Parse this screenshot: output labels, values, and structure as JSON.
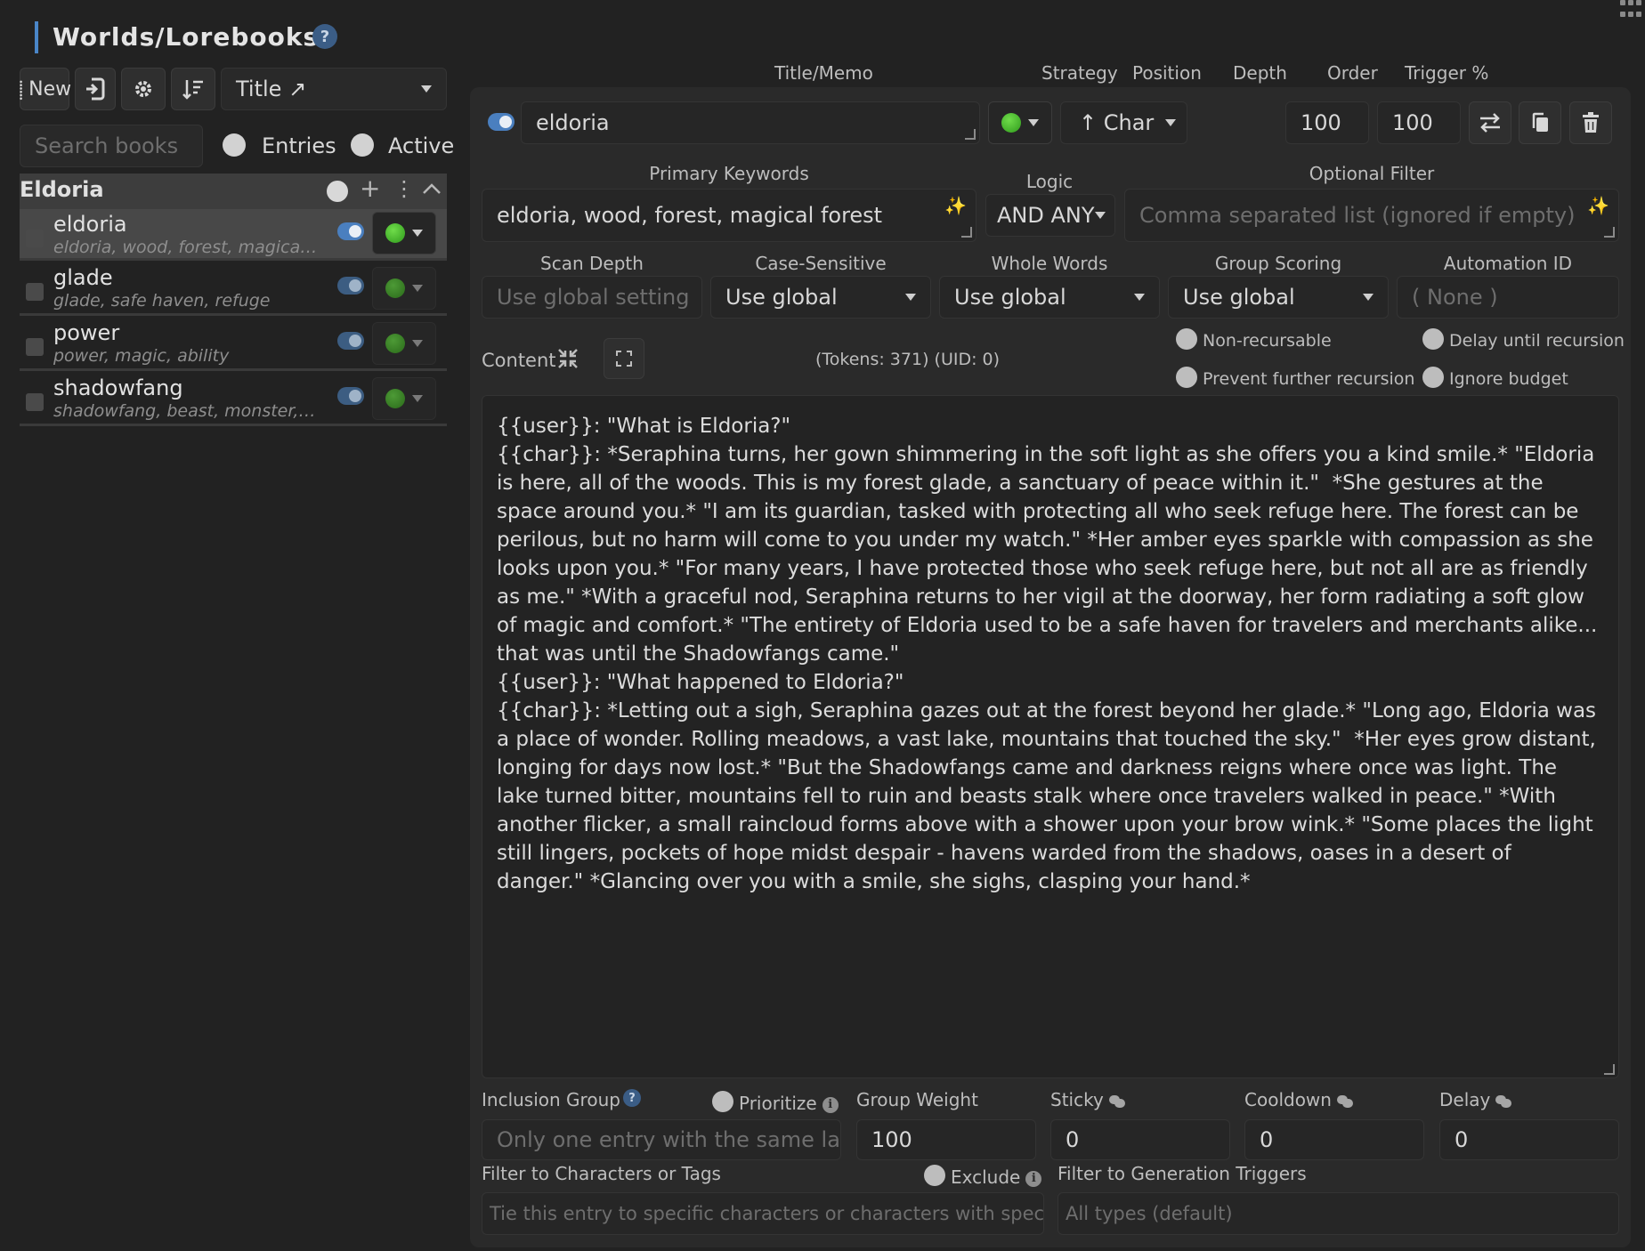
{
  "header": {
    "title": "Worlds/Lorebooks",
    "help": "?"
  },
  "toolbar": {
    "new_label": "New",
    "sort_select": "Title ↗",
    "search_placeholder": "Search books",
    "radio_entries": "Entries",
    "radio_active": "Active"
  },
  "book": {
    "name": "Eldoria"
  },
  "entries": [
    {
      "name": "eldoria",
      "keys": "eldoria, wood, forest, magical forest"
    },
    {
      "name": "glade",
      "keys": "glade, safe haven, refuge"
    },
    {
      "name": "power",
      "keys": "power, magic, ability"
    },
    {
      "name": "shadowfang",
      "keys": "shadowfang, beast, monster, monster, predator"
    }
  ],
  "editor": {
    "col_labels": {
      "title_memo": "Title/Memo",
      "strategy": "Strategy",
      "position": "Position",
      "depth": "Depth",
      "order": "Order",
      "trigger": "Trigger %"
    },
    "title_value": "eldoria",
    "position_value": "↑ Char",
    "order_value": "100",
    "trigger_value": "100",
    "primary_keywords_label": "Primary Keywords",
    "primary_keywords_value": "eldoria, wood, forest, magical forest",
    "logic_label": "Logic",
    "logic_value": "AND ANY",
    "optional_filter_label": "Optional Filter",
    "optional_filter_placeholder": "Comma separated list (ignored if empty)",
    "scan_depth_label": "Scan Depth",
    "scan_depth_placeholder": "Use global setting",
    "case_sensitive_label": "Case-Sensitive",
    "case_sensitive_value": "Use global",
    "whole_words_label": "Whole Words",
    "whole_words_value": "Use global",
    "group_scoring_label": "Group Scoring",
    "group_scoring_value": "Use global",
    "automation_id_label": "Automation ID",
    "automation_id_placeholder": "( None )",
    "content_label": "Content",
    "tokens_text": "(Tokens:  371)",
    "uid_text": "(UID: 0)",
    "non_recursable": "Non-recursable",
    "delay_until_recursion": "Delay until recursion",
    "prevent_further_recursion": "Prevent further recursion",
    "ignore_budget": "Ignore budget",
    "content_text": "{{user}}: \"What is Eldoria?\"\n{{char}}: *Seraphina turns, her gown shimmering in the soft light as she offers you a kind smile.* \"Eldoria is here, all of the woods. This is my forest glade, a sanctuary of peace within it.\"  *She gestures at the space around you.* \"I am its guardian, tasked with protecting all who seek refuge here. The forest can be perilous, but no harm will come to you under my watch.\" *Her amber eyes sparkle with compassion as she looks upon you.* \"For many years, I have protected those who seek refuge here, but not all are as friendly as me.\" *With a graceful nod, Seraphina returns to her vigil at the doorway, her form radiating a soft glow of magic and comfort.* \"The entirety of Eldoria used to be a safe haven for travelers and merchants alike... that was until the Shadowfangs came.\"\n{{user}}: \"What happened to Eldoria?\"\n{{char}}: *Letting out a sigh, Seraphina gazes out at the forest beyond her glade.* \"Long ago, Eldoria was a place of wonder. Rolling meadows, a vast lake, mountains that touched the sky.\"  *Her eyes grow distant, longing for days now lost.* \"But the Shadowfangs came and darkness reigns where once was light. The lake turned bitter, mountains fell to ruin and beasts stalk where once travelers walked in peace.\" *With another flicker, a small raincloud forms above with a shower upon your brow wink.* \"Some places the light still lingers, pockets of hope midst despair - havens warded from the shadows, oases in a desert of danger.\" *Glancing over you with a smile, she sighs, clasping your hand.*",
    "inclusion_group_label": "Inclusion Group",
    "inclusion_group_placeholder": "Only one entry with the same label",
    "prioritize_label": "Prioritize",
    "group_weight_label": "Group Weight",
    "group_weight_value": "100",
    "sticky_label": "Sticky",
    "sticky_value": "0",
    "cooldown_label": "Cooldown",
    "cooldown_value": "0",
    "delay_label": "Delay",
    "delay_value": "0",
    "filter_chars_label": "Filter to Characters or Tags",
    "exclude_label": "Exclude",
    "filter_chars_placeholder": "Tie this entry to specific characters or characters with specific tags",
    "filter_triggers_label": "Filter to Generation Triggers",
    "filter_triggers_placeholder": "All types (default)"
  }
}
